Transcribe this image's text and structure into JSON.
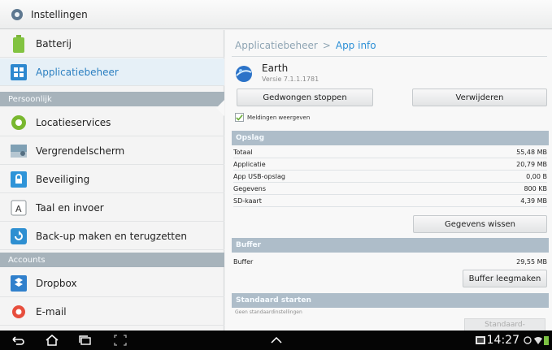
{
  "titlebar": {
    "title": "Instellingen"
  },
  "sidebar": {
    "items_top": [
      {
        "label": "Batterij"
      },
      {
        "label": "Applicatiebeheer"
      }
    ],
    "section_personal": "Persoonlijk",
    "items_personal": [
      {
        "label": "Locatieservices"
      },
      {
        "label": "Vergrendelscherm"
      },
      {
        "label": "Beveiliging"
      },
      {
        "label": "Taal en invoer"
      },
      {
        "label": "Back-up maken en terugzetten"
      }
    ],
    "section_accounts": "Accounts",
    "items_accounts": [
      {
        "label": "Dropbox"
      },
      {
        "label": "E-mail"
      }
    ]
  },
  "breadcrumb": {
    "parent": "Applicatiebeheer",
    "separator": ">",
    "current": "App info"
  },
  "app": {
    "name": "Earth",
    "version": "Versie 7.1.1.1781"
  },
  "buttons": {
    "force_stop": "Gedwongen stoppen",
    "uninstall": "Verwijderen",
    "clear_data": "Gegevens wissen",
    "clear_buffer": "Buffer leegmaken",
    "defaults": "Standaard-"
  },
  "notifications": {
    "label": "Meldingen weergeven",
    "checked": true
  },
  "storage": {
    "header": "Opslag",
    "rows": [
      {
        "label": "Totaal",
        "value": "55,48 MB"
      },
      {
        "label": "Applicatie",
        "value": "20,79 MB"
      },
      {
        "label": "App USB-opslag",
        "value": "0,00 B"
      },
      {
        "label": "Gegevens",
        "value": "800 KB"
      },
      {
        "label": "SD-kaart",
        "value": "4,39 MB"
      }
    ]
  },
  "buffer": {
    "header": "Buffer",
    "label": "Buffer",
    "value": "29,55 MB"
  },
  "default_launch": {
    "header": "Standaard starten",
    "note": "Geen standaardinstellingen"
  },
  "statusbar": {
    "time": "14:27"
  },
  "colors": {
    "accent": "#2b8fd6",
    "section_bg": "#a7b3bb",
    "header_bg": "#aebdc9",
    "selected_bg": "#e6f0f7"
  }
}
